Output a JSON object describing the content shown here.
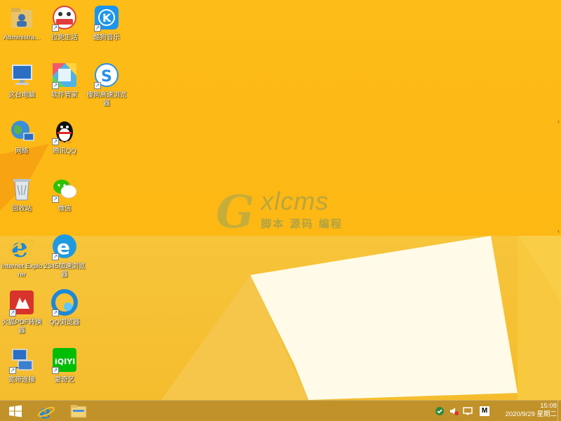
{
  "desktop_icons": [
    {
      "id": "admin",
      "label": "Administra...",
      "icon": "user-folder-icon"
    },
    {
      "id": "lamian",
      "label": "拉免生活",
      "icon": "lamian-app-icon"
    },
    {
      "id": "kugou",
      "label": "酷狗音乐",
      "icon": "kugou-music-icon"
    },
    {
      "id": "computer",
      "label": "这台电脑",
      "icon": "computer-icon"
    },
    {
      "id": "softmgr",
      "label": "软件管家",
      "icon": "software-manager-icon"
    },
    {
      "id": "sogou",
      "label": "搜狗高速浏览器",
      "icon": "sogou-browser-icon"
    },
    {
      "id": "network",
      "label": "网络",
      "icon": "network-globe-icon"
    },
    {
      "id": "qq",
      "label": "腾讯QQ",
      "icon": "qq-penguin-icon"
    },
    {
      "id": "recycle",
      "label": "回收站",
      "icon": "recycle-bin-icon"
    },
    {
      "id": "wechat",
      "label": "微信",
      "icon": "wechat-icon"
    },
    {
      "id": "ie",
      "label": "Internet Explorer",
      "icon": "internet-explorer-icon"
    },
    {
      "id": "2345",
      "label": "2345加速浏览器",
      "icon": "browser-2345-icon"
    },
    {
      "id": "pdf",
      "label": "火狐PDF转换器",
      "icon": "pdf-converter-icon"
    },
    {
      "id": "qqbrowser",
      "label": "QQ浏览器",
      "icon": "qq-browser-icon"
    },
    {
      "id": "broadband",
      "label": "宽带连接",
      "icon": "broadband-connection-icon"
    },
    {
      "id": "iqiyi",
      "label": "爱奇艺",
      "icon": "iqiyi-icon"
    }
  ],
  "watermark": {
    "brand": "xlcms",
    "letter": "G",
    "tagline": "脚本 源码 编程"
  },
  "taskbar": {
    "pinned": [
      {
        "name": "start-button",
        "icon": "windows-logo-icon"
      },
      {
        "name": "taskbar-ie",
        "icon": "internet-explorer-icon"
      },
      {
        "name": "taskbar-explorer",
        "icon": "file-explorer-icon"
      }
    ],
    "tray": [
      {
        "name": "tray-security-icon"
      },
      {
        "name": "tray-volume-muted-icon"
      },
      {
        "name": "tray-network-icon"
      },
      {
        "name": "tray-input-method-icon",
        "text": "M"
      }
    ],
    "time": "15:08",
    "date": "2020/9/29 星期二"
  },
  "colors": {
    "wallpaper": "#fdbc18",
    "taskbar": "#be8c1e",
    "ie_blue": "#1e88d8"
  }
}
